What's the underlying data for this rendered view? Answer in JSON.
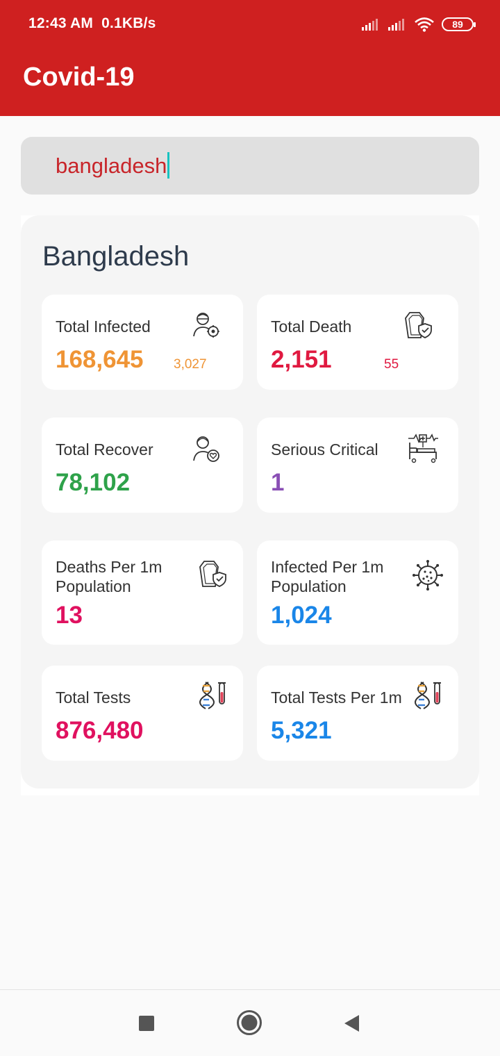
{
  "status_bar": {
    "time": "12:43 AM",
    "speed": "0.1KB/s",
    "battery": "89"
  },
  "app_bar": {
    "title": "Covid-19",
    "color": "#cf2020"
  },
  "search": {
    "value": "bangladesh"
  },
  "country": {
    "name": "Bangladesh"
  },
  "stats": [
    {
      "label": "Total Infected",
      "value": "168,645",
      "sub": "3,027",
      "color": "#ef9435",
      "icon": "infected-person-icon"
    },
    {
      "label": "Total Death",
      "value": "2,151",
      "sub": "55",
      "color": "#e01940",
      "icon": "coffin-shield-icon"
    },
    {
      "label": "Total Recover",
      "value": "78,102",
      "sub": "",
      "color": "#2ea24a",
      "icon": "recovered-person-icon"
    },
    {
      "label": "Serious Critical",
      "value": "1",
      "sub": "",
      "color": "#8a4fb5",
      "icon": "hospital-bed-icon"
    },
    {
      "label": "Deaths Per 1m Population",
      "value": "13",
      "sub": "",
      "color": "#e0115f",
      "icon": "coffin-shield-icon"
    },
    {
      "label": "Infected Per 1m Population",
      "value": "1,024",
      "sub": "",
      "color": "#1a86e8",
      "icon": "virus-icon"
    },
    {
      "label": "Total Tests",
      "value": "876,480",
      "sub": "",
      "color": "#e0115f",
      "icon": "dna-test-tube-icon"
    },
    {
      "label": "Total Tests Per 1m",
      "value": "5,321",
      "sub": "",
      "color": "#1a86e8",
      "icon": "dna-test-tube-icon"
    }
  ]
}
